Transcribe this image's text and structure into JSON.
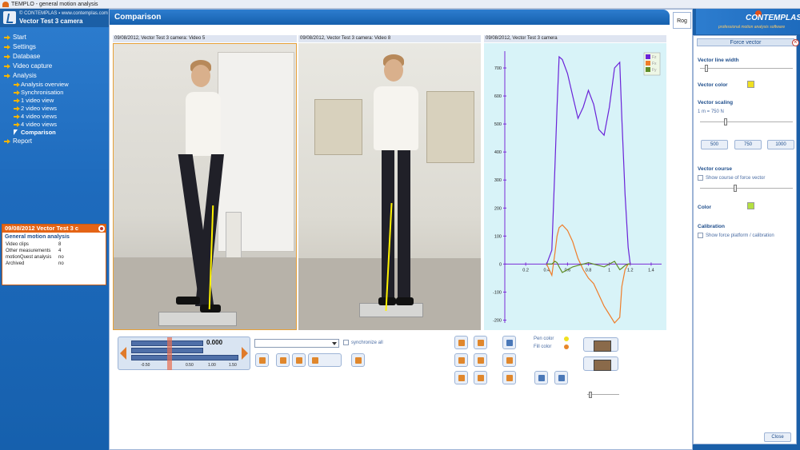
{
  "window": {
    "title": "TEMPLO - general motion analysis"
  },
  "brand": {
    "line1": "© CONTEMPLAS ▪ www.contemplas.com",
    "line2": "Vector Test 3 camera"
  },
  "nav": {
    "items": [
      {
        "label": "Start",
        "level": 0
      },
      {
        "label": "Settings",
        "level": 0
      },
      {
        "label": "Database",
        "level": 0
      },
      {
        "label": "Video capture",
        "level": 0
      },
      {
        "label": "Analysis",
        "level": 0
      },
      {
        "label": "Analysis overview",
        "level": 1
      },
      {
        "label": "Synchronisation",
        "level": 1
      },
      {
        "label": "1 video view",
        "level": 1
      },
      {
        "label": "2 video views",
        "level": 1
      },
      {
        "label": "4 video views",
        "level": 1
      },
      {
        "label": "4 video views",
        "level": 1
      },
      {
        "label": "Comparison",
        "level": 1,
        "active": true
      },
      {
        "label": "Report",
        "level": 0
      }
    ]
  },
  "info": {
    "header": "09/08/2012  Vector Test 3 c",
    "title": "General motion analysis",
    "rows": [
      {
        "label": "Video clips",
        "value": "8"
      },
      {
        "label": "Other measurements",
        "value": "4"
      },
      {
        "label": "motionQuest analysis",
        "value": "no"
      },
      {
        "label": "Archived",
        "value": "no"
      }
    ]
  },
  "main": {
    "title": "Comparison",
    "tab": "Rog",
    "views": [
      "09/08/2012, Vector Test 3 camera: Video 5",
      "09/08/2012, Vector Test 3 camera: Video 8",
      "09/08/2012, Vector Test 3 camera"
    ]
  },
  "chart_data": {
    "type": "line",
    "x": [
      0.4,
      0.45,
      0.48,
      0.5,
      0.52,
      0.55,
      0.6,
      0.65,
      0.7,
      0.75,
      0.8,
      0.85,
      0.9,
      0.95,
      1.0,
      1.05,
      1.1,
      1.12,
      1.15,
      1.18,
      1.2
    ],
    "xticks": [
      "0.2",
      "0.4",
      "0.6",
      "0.8",
      "1",
      "1.2",
      "1.4"
    ],
    "yticks": [
      "700",
      "600",
      "500",
      "400",
      "300",
      "200",
      "100",
      "0",
      "-100",
      "-200"
    ],
    "xlim": [
      0.0,
      1.5
    ],
    "ylim": [
      -210,
      760
    ],
    "series": [
      {
        "name": "Fz",
        "color": "#6a23d8",
        "values": [
          0,
          50,
          350,
          560,
          740,
          730,
          680,
          600,
          520,
          560,
          620,
          570,
          480,
          460,
          560,
          700,
          720,
          520,
          250,
          60,
          0
        ]
      },
      {
        "name": "Fx",
        "color": "#ef7d2a",
        "values": [
          0,
          -40,
          40,
          100,
          130,
          140,
          120,
          80,
          20,
          -20,
          -50,
          -70,
          -110,
          -150,
          -180,
          -210,
          -190,
          -80,
          -20,
          0,
          0
        ]
      },
      {
        "name": "Fy",
        "color": "#5e8c26",
        "values": [
          0,
          0,
          10,
          5,
          -10,
          -30,
          -20,
          -10,
          -5,
          0,
          5,
          0,
          -5,
          -10,
          0,
          10,
          -20,
          -15,
          -5,
          0,
          0
        ]
      }
    ],
    "legend": "top-right"
  },
  "timeline": {
    "value": "0.000",
    "ticks": [
      "-0.50",
      "0.50",
      "1.00",
      "1.50"
    ]
  },
  "controls": {
    "dropdown_value": "",
    "synchronize_label": "synchronize all",
    "pen_color_label": "Pen color",
    "fill_color_label": "Fill color",
    "pen_color": "#f0e020",
    "fill_color": "#e8862a"
  },
  "panel": {
    "title": "Force vector",
    "line_width_label": "Vector line width",
    "vector_color_label": "Vector color",
    "vector_color": "#f0e020",
    "scaling_label": "Vector scaling",
    "scaling_value": "1 m = 750 N",
    "scale_buttons": [
      "500",
      "750",
      "1000"
    ],
    "course_label": "Vector course",
    "course_checkbox": "Show course of force vector",
    "color_label": "Color",
    "course_color": "#b4e040",
    "calibration_label": "Calibration",
    "calibration_checkbox": "Show force platform / calibration",
    "close_label": "Close"
  },
  "logo": {
    "word": "CONTEMPLAS",
    "sub": "professional motion analysis software"
  }
}
